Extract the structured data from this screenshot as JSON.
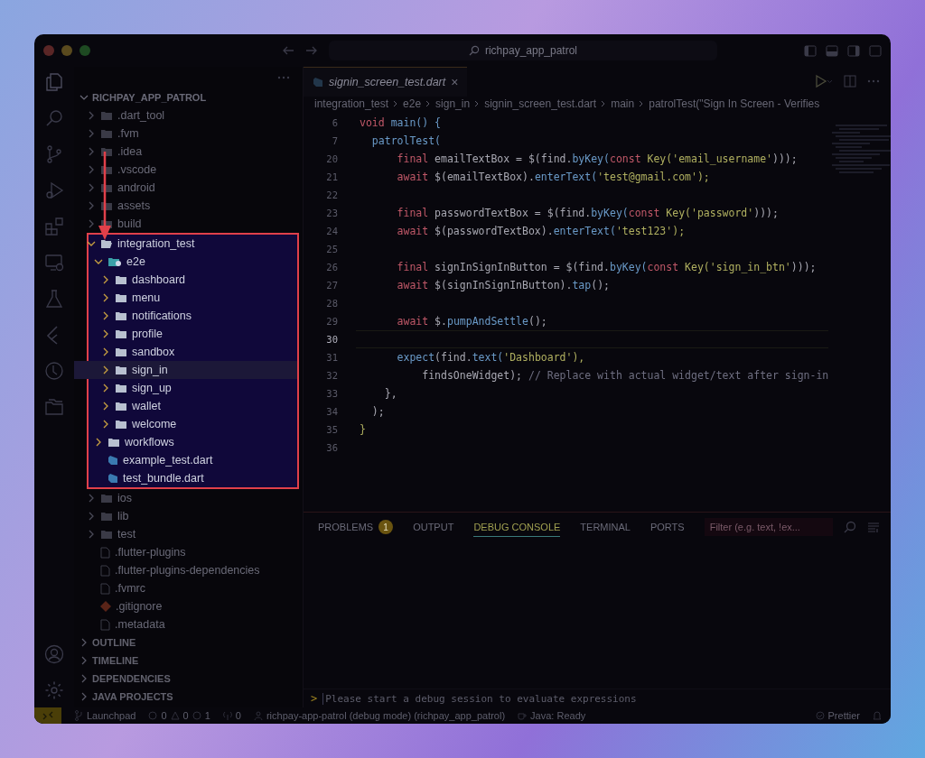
{
  "window": {
    "search": "richpay_app_patrol"
  },
  "sidebar": {
    "project": "RICHPAY_APP_PATROL",
    "tree": [
      {
        "name": ".dart_tool",
        "kind": "folder",
        "expanded": false,
        "selected": false,
        "highlighted": false
      },
      {
        "name": ".fvm",
        "kind": "folder",
        "expanded": false,
        "selected": false,
        "highlighted": false
      },
      {
        "name": ".idea",
        "kind": "folder",
        "expanded": false,
        "selected": false,
        "highlighted": false
      },
      {
        "name": ".vscode",
        "kind": "folder",
        "expanded": false,
        "selected": false,
        "highlighted": false
      },
      {
        "name": "android",
        "kind": "folder",
        "expanded": false,
        "selected": false,
        "highlighted": false
      },
      {
        "name": "assets",
        "kind": "folder",
        "expanded": false,
        "selected": false,
        "highlighted": false
      },
      {
        "name": "build",
        "kind": "folder",
        "expanded": false,
        "selected": false,
        "highlighted": false
      },
      {
        "name": "integration_test",
        "kind": "folder",
        "expanded": true,
        "selected": false,
        "highlighted": true,
        "children": [
          {
            "name": "e2e",
            "kind": "folder-special",
            "expanded": true,
            "selected": false,
            "children": [
              {
                "name": "dashboard",
                "kind": "folder",
                "expanded": false,
                "selected": false
              },
              {
                "name": "menu",
                "kind": "folder",
                "expanded": false,
                "selected": false
              },
              {
                "name": "notifications",
                "kind": "folder",
                "expanded": false,
                "selected": false
              },
              {
                "name": "profile",
                "kind": "folder",
                "expanded": false,
                "selected": false
              },
              {
                "name": "sandbox",
                "kind": "folder",
                "expanded": false,
                "selected": false
              },
              {
                "name": "sign_in",
                "kind": "folder",
                "expanded": false,
                "selected": true
              },
              {
                "name": "sign_up",
                "kind": "folder",
                "expanded": false,
                "selected": false
              },
              {
                "name": "wallet",
                "kind": "folder",
                "expanded": false,
                "selected": false
              },
              {
                "name": "welcome",
                "kind": "folder",
                "expanded": false,
                "selected": false
              }
            ]
          },
          {
            "name": "workflows",
            "kind": "folder",
            "expanded": false,
            "selected": false
          },
          {
            "name": "example_test.dart",
            "kind": "dart",
            "selected": false
          },
          {
            "name": "test_bundle.dart",
            "kind": "dart",
            "selected": false
          }
        ]
      },
      {
        "name": "ios",
        "kind": "folder",
        "expanded": false,
        "selected": false,
        "highlighted": false
      },
      {
        "name": "lib",
        "kind": "folder",
        "expanded": false,
        "selected": false,
        "highlighted": false
      },
      {
        "name": "test",
        "kind": "folder",
        "expanded": false,
        "selected": false,
        "highlighted": false
      },
      {
        "name": ".flutter-plugins",
        "kind": "file",
        "selected": false,
        "highlighted": false
      },
      {
        "name": ".flutter-plugins-dependencies",
        "kind": "file",
        "selected": false,
        "highlighted": false
      },
      {
        "name": ".fvmrc",
        "kind": "file",
        "selected": false,
        "highlighted": false
      },
      {
        "name": ".gitignore",
        "kind": "git",
        "selected": false,
        "highlighted": false
      },
      {
        "name": ".metadata",
        "kind": "file",
        "selected": false,
        "highlighted": false
      }
    ],
    "sections": [
      "OUTLINE",
      "TIMELINE",
      "DEPENDENCIES",
      "JAVA PROJECTS"
    ]
  },
  "editor": {
    "tab": {
      "label": "signin_screen_test.dart",
      "close": "×"
    },
    "breadcrumbs": [
      "integration_test",
      "e2e",
      "sign_in",
      "signin_screen_test.dart",
      "main",
      "patrolTest(\"Sign In Screen - Verifies"
    ],
    "lines": [
      {
        "number": "6",
        "current": false,
        "tokens": [
          {
            "t": "void ",
            "color": "#c05868"
          },
          {
            "t": "main() {",
            "color": "#6a9ac8"
          }
        ]
      },
      {
        "number": "7",
        "current": false,
        "tokens": [
          {
            "t": "  patrolTest(",
            "color": "#6a9ac8"
          }
        ]
      },
      {
        "number": "20",
        "current": false,
        "tokens": [
          {
            "t": "      final ",
            "color": "#c05868"
          },
          {
            "t": "emailTextBox = $(find.",
            "color": "#a8a8b2"
          },
          {
            "t": "byKey(",
            "color": "#6a9ac8"
          },
          {
            "t": "const ",
            "color": "#c05868"
          },
          {
            "t": "Key(",
            "color": "#b0b060"
          },
          {
            "t": "'email_username'",
            "color": "#b0b060"
          },
          {
            "t": ")));",
            "color": "#a8a8b2"
          }
        ]
      },
      {
        "number": "21",
        "current": false,
        "tokens": [
          {
            "t": "      await ",
            "color": "#c05868"
          },
          {
            "t": "$(emailTextBox).",
            "color": "#a8a8b2"
          },
          {
            "t": "enterText(",
            "color": "#6a9ac8"
          },
          {
            "t": "'test@gmail.com');",
            "color": "#b0b060"
          }
        ]
      },
      {
        "number": "22",
        "current": false
      },
      {
        "number": "23",
        "current": false,
        "tokens": [
          {
            "t": "      final ",
            "color": "#c05868"
          },
          {
            "t": "passwordTextBox = $(find.",
            "color": "#a8a8b2"
          },
          {
            "t": "byKey(",
            "color": "#6a9ac8"
          },
          {
            "t": "const ",
            "color": "#c05868"
          },
          {
            "t": "Key(",
            "color": "#b0b060"
          },
          {
            "t": "'password'",
            "color": "#b0b060"
          },
          {
            "t": ")));",
            "color": "#a8a8b2"
          }
        ]
      },
      {
        "number": "24",
        "current": false,
        "tokens": [
          {
            "t": "      await ",
            "color": "#c05868"
          },
          {
            "t": "$(passwordTextBox).",
            "color": "#a8a8b2"
          },
          {
            "t": "enterText(",
            "color": "#6a9ac8"
          },
          {
            "t": "'test123');",
            "color": "#b0b060"
          }
        ]
      },
      {
        "number": "25",
        "current": false
      },
      {
        "number": "26",
        "current": false,
        "tokens": [
          {
            "t": "      final ",
            "color": "#c05868"
          },
          {
            "t": "signInSignInButton = $(find.",
            "color": "#a8a8b2"
          },
          {
            "t": "byKey(",
            "color": "#6a9ac8"
          },
          {
            "t": "const ",
            "color": "#c05868"
          },
          {
            "t": "Key(",
            "color": "#b0b060"
          },
          {
            "t": "'sign_in_btn'",
            "color": "#b0b060"
          },
          {
            "t": ")));",
            "color": "#a8a8b2"
          }
        ]
      },
      {
        "number": "27",
        "current": false,
        "tokens": [
          {
            "t": "      await ",
            "color": "#c05868"
          },
          {
            "t": "$(signInSignInButton).",
            "color": "#a8a8b2"
          },
          {
            "t": "tap",
            "color": "#6a9ac8"
          },
          {
            "t": "();",
            "color": "#a8a8b2"
          }
        ]
      },
      {
        "number": "28",
        "current": false
      },
      {
        "number": "29",
        "current": false,
        "tokens": [
          {
            "t": "      await ",
            "color": "#c05868"
          },
          {
            "t": "$.",
            "color": "#a8a8b2"
          },
          {
            "t": "pumpAndSettle",
            "color": "#6a9ac8"
          },
          {
            "t": "();",
            "color": "#a8a8b2"
          }
        ]
      },
      {
        "number": "30",
        "current": true
      },
      {
        "number": "31",
        "current": false,
        "tokens": [
          {
            "t": "      expect",
            "color": "#6a9ac8"
          },
          {
            "t": "(find.",
            "color": "#a8a8b2"
          },
          {
            "t": "text(",
            "color": "#6a9ac8"
          },
          {
            "t": "'Dashboard'),",
            "color": "#b0b060"
          }
        ]
      },
      {
        "number": "32",
        "current": false,
        "tokens": [
          {
            "t": "          findsOneWidget); ",
            "color": "#a8a8b2"
          },
          {
            "t": "// Replace with actual widget/text after sign-in",
            "color": "#6e6e80"
          }
        ]
      },
      {
        "number": "33",
        "current": false,
        "tokens": [
          {
            "t": "    },",
            "color": "#a8a8b2"
          }
        ]
      },
      {
        "number": "34",
        "current": false,
        "tokens": [
          {
            "t": "  );",
            "color": "#a8a8b2"
          }
        ]
      },
      {
        "number": "35",
        "current": false,
        "tokens": [
          {
            "t": "}",
            "color": "#b0b060"
          }
        ]
      },
      {
        "number": "36",
        "current": false
      }
    ]
  },
  "panel": {
    "tabs": [
      {
        "label": "PROBLEMS",
        "badge": "1",
        "selected": false
      },
      {
        "label": "OUTPUT",
        "selected": false
      },
      {
        "label": "DEBUG CONSOLE",
        "selected": true
      },
      {
        "label": "TERMINAL",
        "selected": false
      },
      {
        "label": "PORTS",
        "selected": false
      }
    ],
    "filter": {
      "placeholder": "Filter (e.g. text, !ex..."
    },
    "prompt": ">",
    "console": {
      "placeholder": "Please start a debug session to evaluate expressions"
    }
  },
  "status_bar": {
    "branch": "Launchpad",
    "errors": "0",
    "warnings": "0",
    "infos": "1",
    "ports": "0",
    "session": "richpay-app-patrol (debug mode) (richpay_app_patrol)",
    "java": "Java: Ready",
    "prettier": "Prettier"
  }
}
